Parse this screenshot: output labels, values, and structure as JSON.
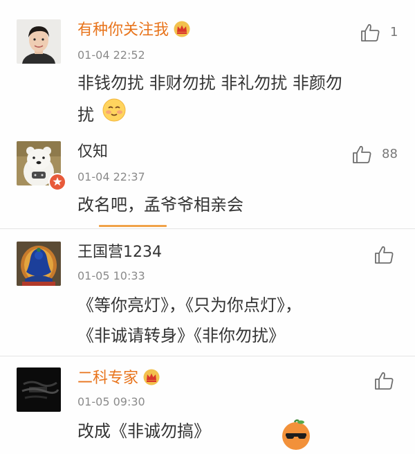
{
  "comments": [
    {
      "username": "有种你关注我",
      "timestamp": "01-04 22:52",
      "text_line1": "非钱勿扰 非财勿扰 非礼勿扰 非颜勿",
      "text_line2": "扰",
      "like_count": "1",
      "has_crown": true,
      "emoji": "smiling-face-icon"
    },
    {
      "username": "仅知",
      "timestamp": "01-04 22:37",
      "text_line1": "改名吧，孟爷爷相亲会",
      "like_count": "88",
      "has_badge": true
    },
    {
      "username": "王国营1234",
      "timestamp": "01-05 10:33",
      "text_line1": "《等你亮灯》，《只为你点灯》，",
      "text_line2": "《非诚请转身》《非你勿扰》",
      "like_count": ""
    },
    {
      "username": "二科专家",
      "timestamp": "01-05 09:30",
      "text_line1": "改成《非诚勿搞》",
      "like_count": "",
      "has_crown": true
    }
  ],
  "colors": {
    "vip_name": "#e8741c",
    "normal_name": "#333333",
    "timestamp": "#8a8a8a",
    "tab_indicator": "#f0a248",
    "badge": "#e85a3a"
  }
}
